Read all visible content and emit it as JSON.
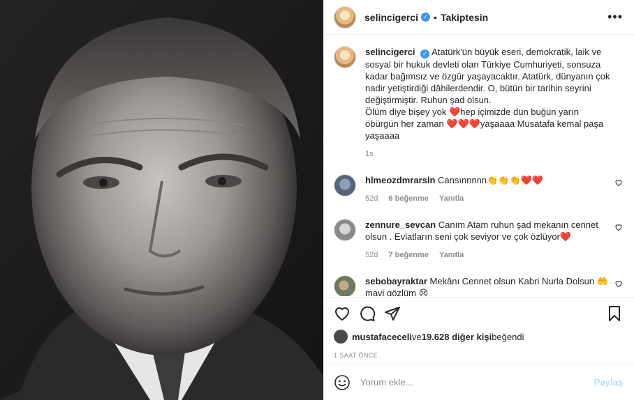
{
  "header": {
    "username": "selincigerci",
    "verified_icon": "verified-badge-icon",
    "separator": "•",
    "follow_status": "Takiptesin",
    "more_icon": "more-options-icon"
  },
  "caption": {
    "username": "selincigerci",
    "text": "Atatürk'ün büyük eseri, demokratik, laik ve sosyal bir hukuk devleti olan Türkiye Cumhuriyeti, sonsuza kadar bağımsız ve özgür yaşayacaktır. Atatürk, dünyanın çok nadir yetiştirdiği dâhilerdendir. O, bütün bir tarihin seyrini değiştirmiştir. Ruhun şad olsun.",
    "text2_a": "Ölüm diye bişey yok ",
    "heart1": "❤️",
    "text2_b": "hep içimizde dün buğün yarın öbürgün her zaman ",
    "hearts3": "❤️❤️❤️",
    "text2_c": "yaşaaaa Musatafa kemal paşa yaşaaaa",
    "time": "1s"
  },
  "comments": [
    {
      "username": "hlmeozdmrarsln",
      "text": "Cansınnnnn👏👏👏❤️❤️",
      "time": "52d",
      "likes": "6 beğenme",
      "reply": "Yanıtla"
    },
    {
      "username": "zennure_sevcan",
      "text": "Canım Atam ruhun şad mekanın cennet olsun . Evlatların seni çok seviyor ve çok özlüyor❤️",
      "time": "52d",
      "likes": "7 beğenme",
      "reply": "Yanıtla"
    },
    {
      "username": "sebobayraktar",
      "text": "Mekânı Cennet olsun Kabri Nurla Dolsun 🤲 mavi gözlüm 😢"
    }
  ],
  "likes": {
    "liker": "mustafaceceli",
    "and": " ve ",
    "others": "19.628 diğer kişi",
    "liked": " beğendi"
  },
  "time_ago": "1 SAAT ÖNCE",
  "add_comment": {
    "placeholder": "Yorum ekle...",
    "share_label": "Paylaş"
  },
  "colors": {
    "accent": "#3897f0",
    "heart": "#ed4956",
    "muted": "#8e8e8e",
    "share_disabled": "#b2dffc"
  }
}
